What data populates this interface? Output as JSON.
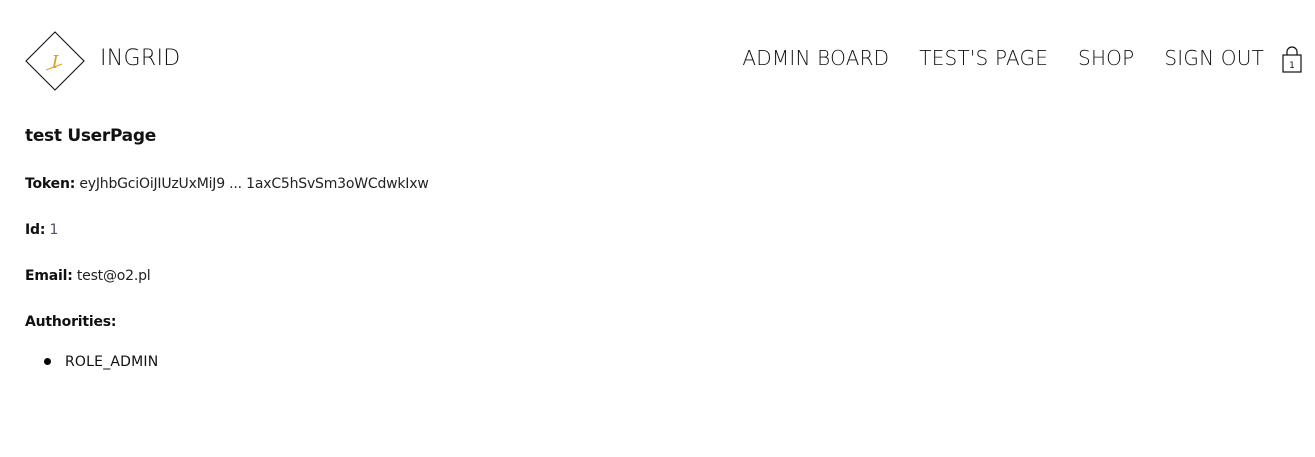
{
  "header": {
    "brand": "INGRID",
    "logo_letter": "I",
    "nav": [
      {
        "label": "ADMIN BOARD"
      },
      {
        "label": "TEST'S PAGE"
      },
      {
        "label": "SHOP"
      },
      {
        "label": "SIGN OUT"
      }
    ],
    "cart_count": "1",
    "logo_accent_color": "#e0a020"
  },
  "main": {
    "title": "test UserPage",
    "token": {
      "label": "Token:",
      "value": "eyJhbGciOiJIUzUxMiJ9 ... 1axC5hSvSm3oWCdwkIxw"
    },
    "id": {
      "label": "Id:",
      "value": "1"
    },
    "email": {
      "label": "Email:",
      "value": "test@o2.pl"
    },
    "authorities": {
      "label": "Authorities:",
      "items": [
        "ROLE_ADMIN"
      ]
    }
  }
}
